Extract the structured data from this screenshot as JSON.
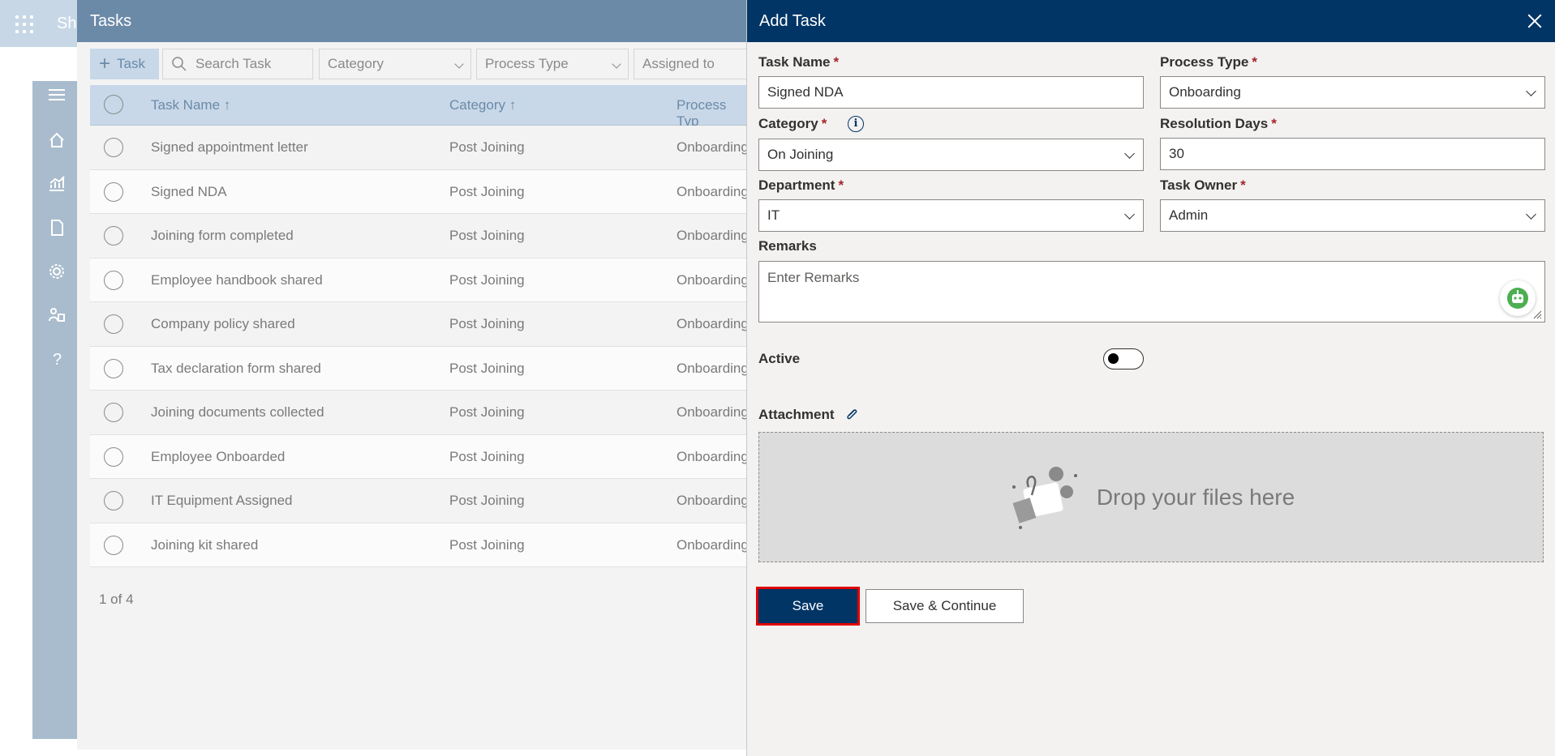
{
  "background": {
    "app_name": "Sha",
    "tasks": {
      "title": "Tasks",
      "toolbar": {
        "add_label": "Task",
        "search_placeholder": "Search Task",
        "category_filter": "Category",
        "process_type_filter": "Process Type",
        "assigned_to_filter": "Assigned to"
      },
      "columns": [
        "Task Name ↑",
        "Category ↑",
        "Process Typ"
      ],
      "rows": [
        {
          "name": "Signed appointment letter",
          "category": "Post Joining",
          "process": "Onboarding"
        },
        {
          "name": "Signed NDA",
          "category": "Post Joining",
          "process": "Onboarding"
        },
        {
          "name": "Joining form completed",
          "category": "Post Joining",
          "process": "Onboarding"
        },
        {
          "name": "Employee handbook shared",
          "category": "Post Joining",
          "process": "Onboarding"
        },
        {
          "name": "Company policy shared",
          "category": "Post Joining",
          "process": "Onboarding"
        },
        {
          "name": "Tax declaration form shared",
          "category": "Post Joining",
          "process": "Onboarding"
        },
        {
          "name": "Joining documents collected",
          "category": "Post Joining",
          "process": "Onboarding"
        },
        {
          "name": "Employee Onboarded",
          "category": "Post Joining",
          "process": "Onboarding"
        },
        {
          "name": "IT Equipment Assigned",
          "category": "Post Joining",
          "process": "Onboarding"
        },
        {
          "name": "Joining kit shared",
          "category": "Post Joining",
          "process": "Onboarding"
        }
      ],
      "pager": "1 of 4"
    }
  },
  "add_task": {
    "title": "Add Task",
    "fields": {
      "task_name": {
        "label": "Task Name",
        "value": "Signed NDA",
        "required": "*"
      },
      "process_type": {
        "label": "Process Type",
        "value": "Onboarding",
        "required": "*"
      },
      "category": {
        "label": "Category",
        "value": "On Joining",
        "required": "*"
      },
      "resolution_days": {
        "label": "Resolution Days",
        "value": "30",
        "required": "*"
      },
      "department": {
        "label": "Department",
        "value": "IT",
        "required": "*"
      },
      "task_owner": {
        "label": "Task Owner",
        "value": "Admin",
        "required": "*"
      },
      "remarks": {
        "label": "Remarks",
        "placeholder": "Enter Remarks"
      },
      "active": {
        "label": "Active",
        "on": false
      },
      "attachment": {
        "label": "Attachment",
        "drop_text": "Drop your files here"
      }
    },
    "buttons": {
      "save": "Save",
      "save_continue": "Save & Continue"
    }
  },
  "colors": {
    "header_navy": "#003566",
    "tasks_header": "#6b8aa8",
    "required": "#a4262c",
    "highlight": "#e00000"
  }
}
